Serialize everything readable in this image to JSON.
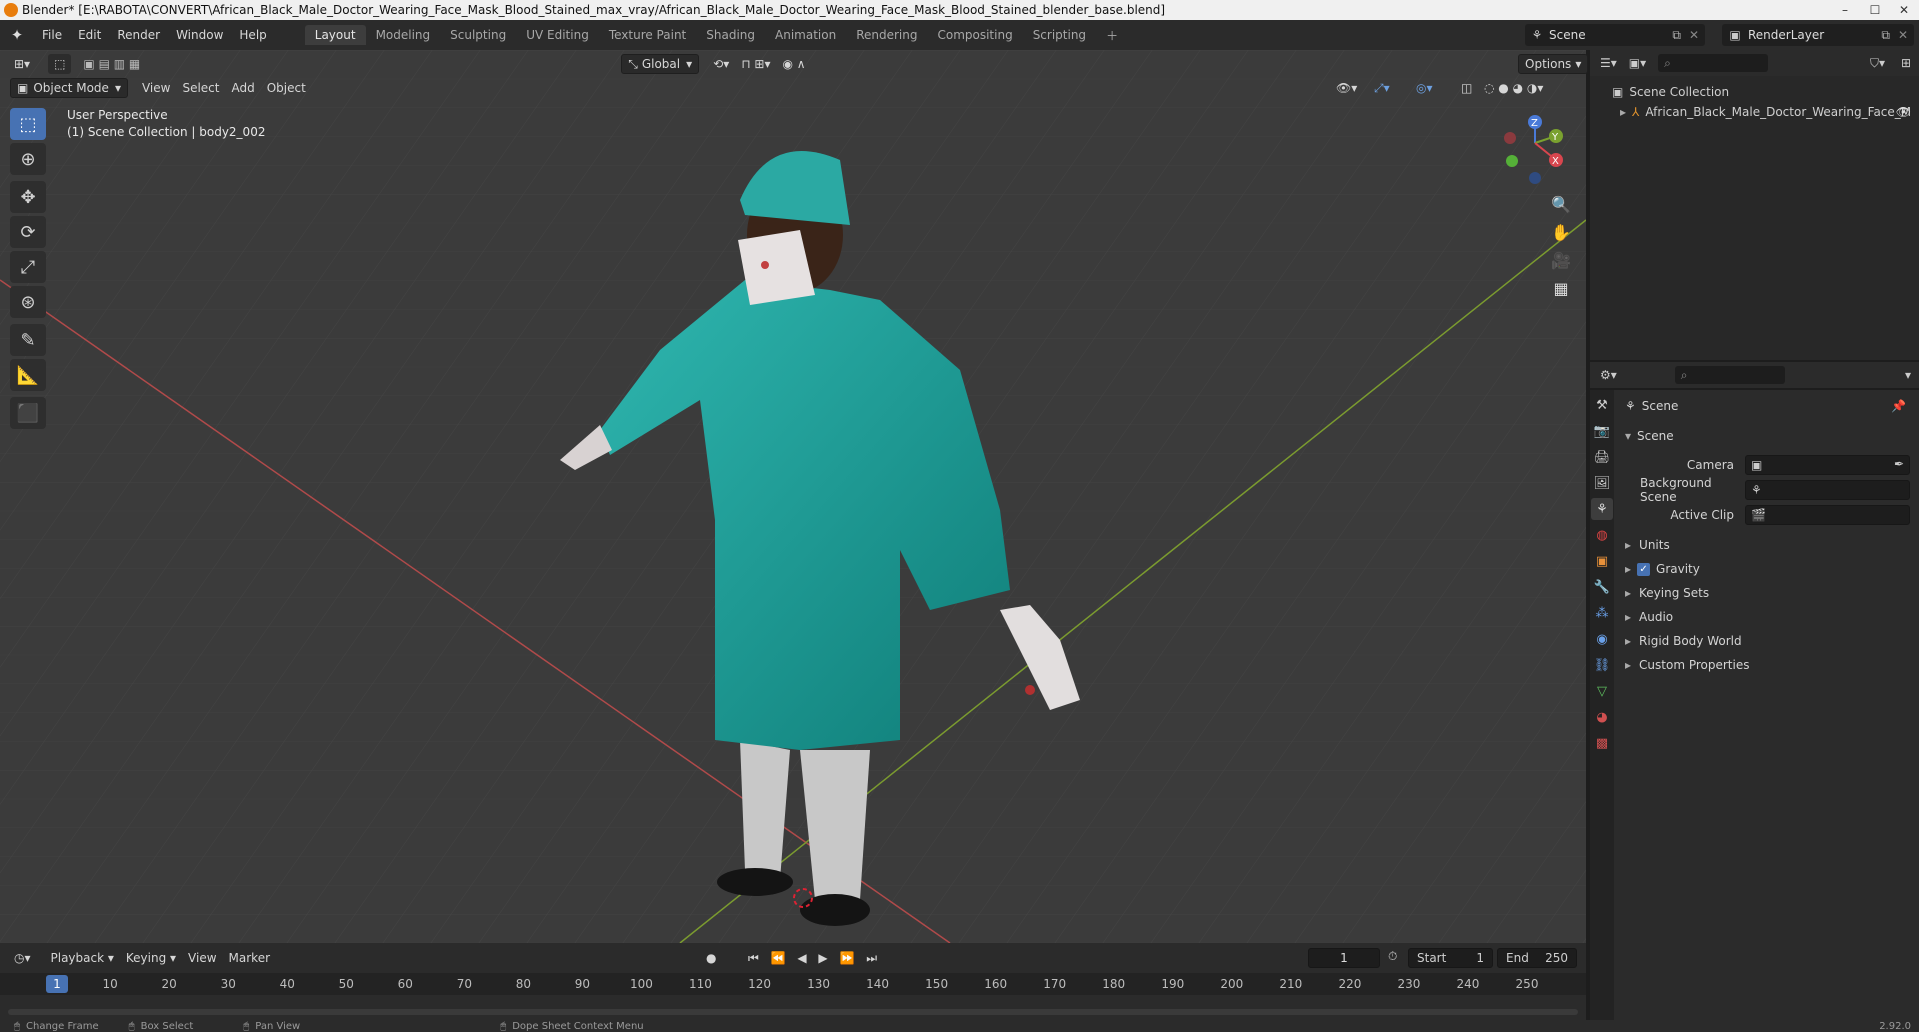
{
  "title_bar": {
    "title": "Blender* [E:\\RABOTA\\CONVERT\\African_Black_Male_Doctor_Wearing_Face_Mask_Blood_Stained_max_vray/African_Black_Male_Doctor_Wearing_Face_Mask_Blood_Stained_blender_base.blend]",
    "min": "–",
    "max": "☐",
    "close": "✕"
  },
  "menu": {
    "items": [
      "File",
      "Edit",
      "Render",
      "Window",
      "Help"
    ]
  },
  "workspaces": [
    {
      "label": "Layout",
      "active": true
    },
    {
      "label": "Modeling"
    },
    {
      "label": "Sculpting"
    },
    {
      "label": "UV Editing"
    },
    {
      "label": "Texture Paint"
    },
    {
      "label": "Shading"
    },
    {
      "label": "Animation"
    },
    {
      "label": "Rendering"
    },
    {
      "label": "Compositing"
    },
    {
      "label": "Scripting"
    }
  ],
  "top_right": {
    "scene": "Scene",
    "render_layer": "RenderLayer"
  },
  "viewport_header": {
    "mode": "Object Mode",
    "menus": [
      "View",
      "Select",
      "Add",
      "Object"
    ],
    "transform_orientation": "Global",
    "options": "Options"
  },
  "viewport_info": {
    "line1": "User Perspective",
    "line2": "(1) Scene Collection | body2_002"
  },
  "gizmo": {
    "x": "X",
    "y": "Y",
    "z": "Z"
  },
  "outliner": {
    "root": "Scene Collection",
    "item": "African_Black_Male_Doctor_Wearing_Face_M"
  },
  "properties": {
    "header": "Scene",
    "panel": "Scene",
    "camera_label": "Camera",
    "bg_scene_label": "Background Scene",
    "active_clip_label": "Active Clip",
    "sections": [
      "Units",
      "Gravity",
      "Keying Sets",
      "Audio",
      "Rigid Body World",
      "Custom Properties"
    ]
  },
  "timeline": {
    "menus": [
      "Playback",
      "Keying",
      "View",
      "Marker"
    ],
    "current_frame": "1",
    "start_label": "Start",
    "start": "1",
    "end_label": "End",
    "end": "250",
    "ticks": [
      "1",
      "10",
      "20",
      "30",
      "40",
      "50",
      "60",
      "70",
      "80",
      "90",
      "100",
      "110",
      "120",
      "130",
      "140",
      "150",
      "160",
      "170",
      "180",
      "190",
      "200",
      "210",
      "220",
      "230",
      "240",
      "250"
    ]
  },
  "status": {
    "items": [
      "Change Frame",
      "Box Select",
      "Pan View",
      "Dope Sheet Context Menu"
    ],
    "version": "2.92.0"
  }
}
